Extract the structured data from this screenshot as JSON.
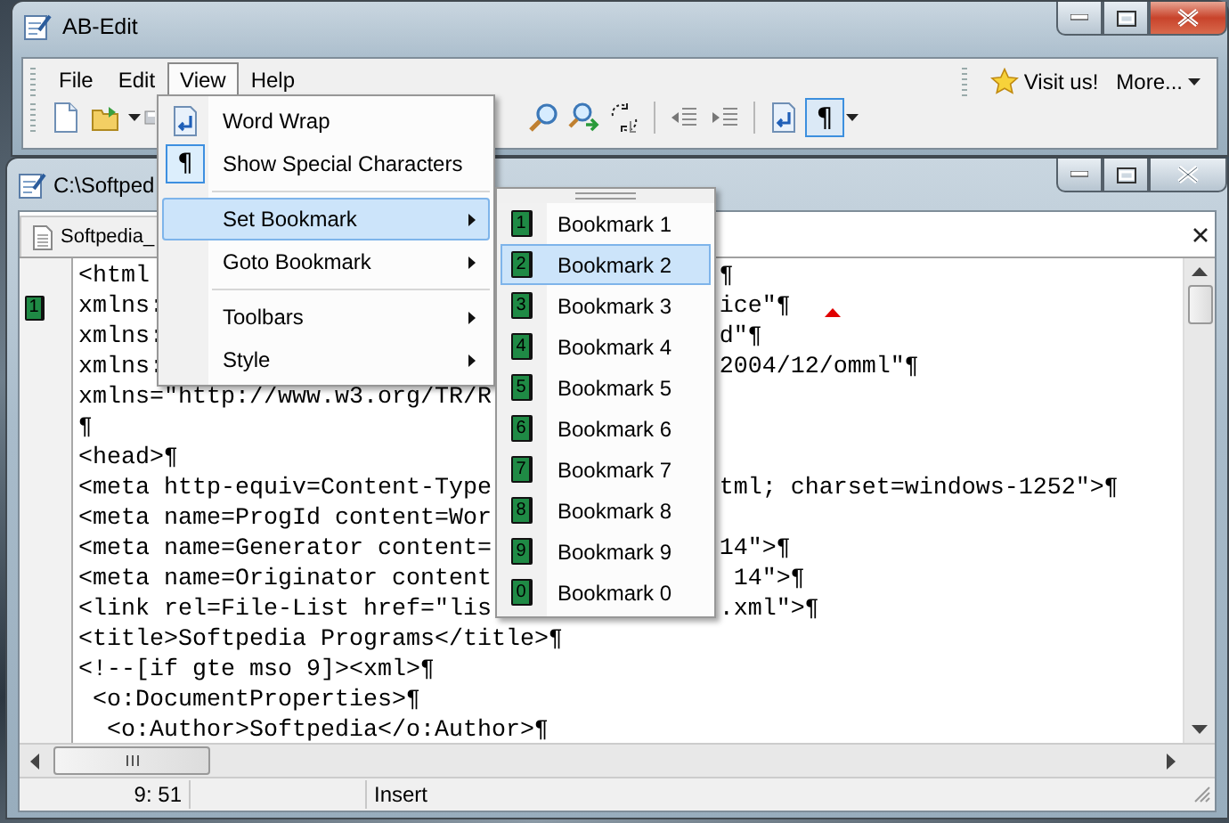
{
  "main_window": {
    "title": "AB-Edit",
    "menu_bar": [
      {
        "label": "File",
        "selected": false
      },
      {
        "label": "Edit",
        "selected": false
      },
      {
        "label": "View",
        "selected": true
      },
      {
        "label": "Help",
        "selected": false
      }
    ],
    "links": [
      {
        "kind": "star",
        "label": "Visit us!"
      },
      {
        "kind": "dropdown",
        "label": "More..."
      }
    ],
    "toolbar": {
      "pilcrow": "¶",
      "pilcrow_pressed": true
    }
  },
  "child_window": {
    "title": "C:\\Softped",
    "tab": {
      "label": "Softpedia_"
    },
    "editor": {
      "lines": [
        {
          "text": "<html",
          "tail": "¶"
        },
        {
          "text": "xmlns:",
          "tail": "ice\"¶",
          "bookmark": "1"
        },
        {
          "text": "xmlns:",
          "tail": "d\"¶"
        },
        {
          "text": "xmlns:",
          "tail": "2004/12/omml\"¶"
        },
        {
          "text": "xmlns=\"http://www.w3.org/TR/R"
        },
        {
          "text": "¶"
        },
        {
          "text": "<head>¶"
        },
        {
          "text": "<meta http-equiv=Content-Type",
          "tail": "tml; charset=windows-1252\">¶"
        },
        {
          "text": "<meta name=ProgId content=Wor"
        },
        {
          "text": "<meta name=Generator content=",
          "tail": "14\">¶"
        },
        {
          "text": "<meta name=Originator content",
          "tail": " 14\">¶"
        },
        {
          "text": "<link rel=File-List href=\"lis",
          "tail": ".xml\">¶"
        },
        {
          "text": "<title>Softpedia Programs</title>¶"
        },
        {
          "text": "<!--[if gte mso 9]><xml>¶"
        },
        {
          "text": " <o:DocumentProperties>¶"
        },
        {
          "text": "  <o:Author>Softpedia</o:Author>¶"
        }
      ]
    },
    "status_bar": {
      "position": "9: 51",
      "mode": "Insert"
    }
  },
  "view_menu": [
    {
      "kind": "command",
      "label": "Word Wrap",
      "checked": false,
      "selected": false
    },
    {
      "kind": "command",
      "label": "Show Special Characters",
      "glyph": "¶",
      "checked": true,
      "selected": false
    },
    {
      "kind": "separator"
    },
    {
      "kind": "submenu",
      "label": "Set Bookmark",
      "selected": true
    },
    {
      "kind": "submenu",
      "label": "Goto Bookmark",
      "selected": false
    },
    {
      "kind": "separator"
    },
    {
      "kind": "submenu",
      "label": "Toolbars",
      "selected": false
    },
    {
      "kind": "submenu",
      "label": "Style",
      "selected": false
    }
  ],
  "bookmark_menu": [
    {
      "digit": "1",
      "label": "Bookmark 1",
      "selected": false
    },
    {
      "digit": "2",
      "label": "Bookmark 2",
      "selected": true
    },
    {
      "digit": "3",
      "label": "Bookmark 3",
      "selected": false
    },
    {
      "digit": "4",
      "label": "Bookmark 4",
      "selected": false
    },
    {
      "digit": "5",
      "label": "Bookmark 5",
      "selected": false
    },
    {
      "digit": "6",
      "label": "Bookmark 6",
      "selected": false
    },
    {
      "digit": "7",
      "label": "Bookmark 7",
      "selected": false
    },
    {
      "digit": "8",
      "label": "Bookmark 8",
      "selected": false
    },
    {
      "digit": "9",
      "label": "Bookmark 9",
      "selected": false
    },
    {
      "digit": "0",
      "label": "Bookmark 0",
      "selected": false
    }
  ]
}
